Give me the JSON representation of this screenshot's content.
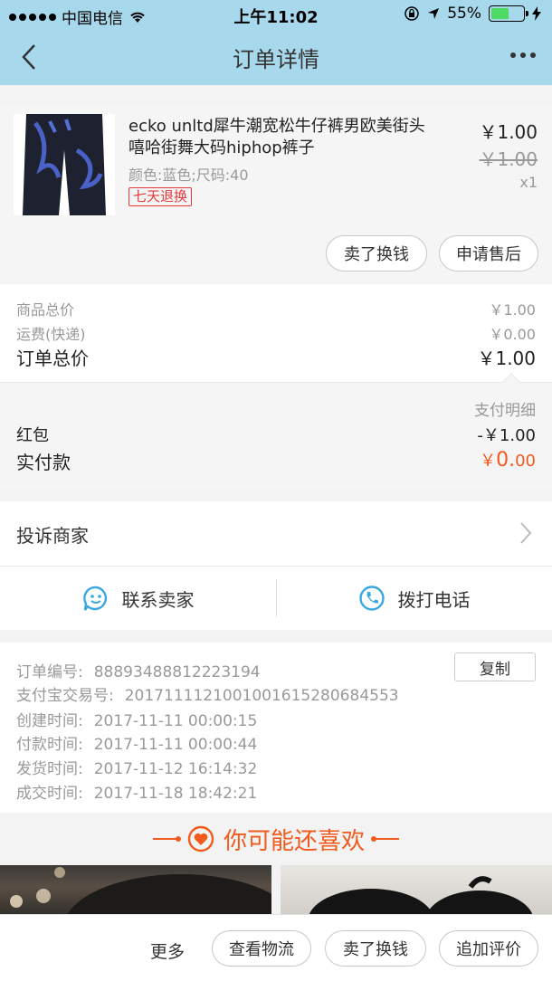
{
  "status_bar": {
    "carrier": "中国电信",
    "time": "上午11:02",
    "battery_percent": "55%",
    "battery_level": 0.55
  },
  "nav": {
    "title": "订单详情"
  },
  "product": {
    "name": "ecko unltd犀牛潮宽松牛仔裤男欧美街头嘻哈街舞大码hiphop裤子",
    "spec": "颜色:蓝色;尺码:40",
    "tag": "七天退换",
    "price": "￥1.00",
    "original_price": "￥1.00",
    "quantity": "x1",
    "actions": [
      "卖了换钱",
      "申请售后"
    ]
  },
  "summary": {
    "rows": [
      {
        "label": "商品总价",
        "value": "￥1.00"
      },
      {
        "label": "运费(快递)",
        "value": "￥0.00"
      }
    ],
    "total_label": "订单总价",
    "total_value": "￥1.00"
  },
  "payment": {
    "detail_link": "支付明细",
    "red_packet_label": "红包",
    "red_packet_value": "-￥1.00",
    "paid_label": "实付款",
    "paid_currency": "￥",
    "paid_int": "0.",
    "paid_dec": "00",
    "accent_color": "#f25a1d"
  },
  "complain": {
    "label": "投诉商家"
  },
  "contact": {
    "seller": "联系卖家",
    "phone": "拨打电话",
    "icon_color": "#39a8e0"
  },
  "order_info": {
    "copy_label": "复制",
    "rows": [
      {
        "label": "订单编号:",
        "value": "88893488812223194"
      },
      {
        "label": "支付宝交易号:",
        "value": "2017111121001001615280684553"
      },
      {
        "label": "创建时间:",
        "value": "2017-11-11 00:00:15"
      },
      {
        "label": "付款时间:",
        "value": "2017-11-11 00:00:44"
      },
      {
        "label": "发货时间:",
        "value": "2017-11-12 16:14:32"
      },
      {
        "label": "成交时间:",
        "value": "2017-11-18 18:42:21"
      }
    ]
  },
  "recommend": {
    "title": "你可能还喜欢"
  },
  "bottom_bar": {
    "more": "更多",
    "buttons": [
      "查看物流",
      "卖了换钱",
      "追加评价"
    ]
  }
}
